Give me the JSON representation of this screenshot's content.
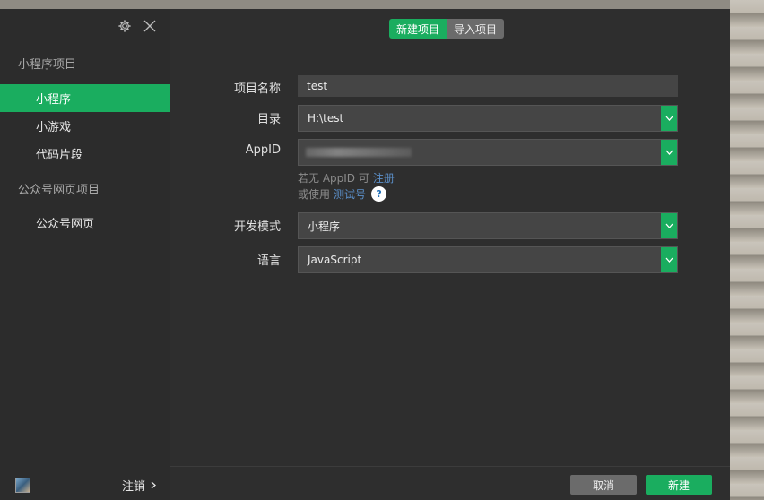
{
  "sidebar": {
    "section_miniprogram": "小程序项目",
    "items_miniprogram": [
      {
        "label": "小程序",
        "active": true
      },
      {
        "label": "小游戏",
        "active": false
      },
      {
        "label": "代码片段",
        "active": false
      }
    ],
    "section_official": "公众号网页项目",
    "items_official": [
      {
        "label": "公众号网页",
        "active": false
      }
    ],
    "logout_label": "注销",
    "icons": {
      "settings": "gear-icon",
      "close": "close-icon",
      "chevron": "chevron-right-icon"
    }
  },
  "tabs": [
    {
      "label": "新建项目",
      "active": true
    },
    {
      "label": "导入项目",
      "active": false
    }
  ],
  "form": {
    "project_name": {
      "label": "项目名称",
      "value": "test"
    },
    "directory": {
      "label": "目录",
      "value": "H:\\test"
    },
    "appid": {
      "label": "AppID",
      "value": ""
    },
    "appid_hint_prefix": "若无 AppID 可",
    "appid_hint_link": "注册",
    "test_hint_prefix": "或使用",
    "test_hint_link": "测试号",
    "help_symbol": "?",
    "dev_mode": {
      "label": "开发模式",
      "value": "小程序"
    },
    "language": {
      "label": "语言",
      "value": "JavaScript"
    }
  },
  "footer": {
    "cancel_label": "取消",
    "create_label": "新建"
  },
  "colors": {
    "accent": "#1aad5f",
    "background": "#2e2e2e",
    "field": "#454545",
    "link": "#5b8fc9"
  }
}
